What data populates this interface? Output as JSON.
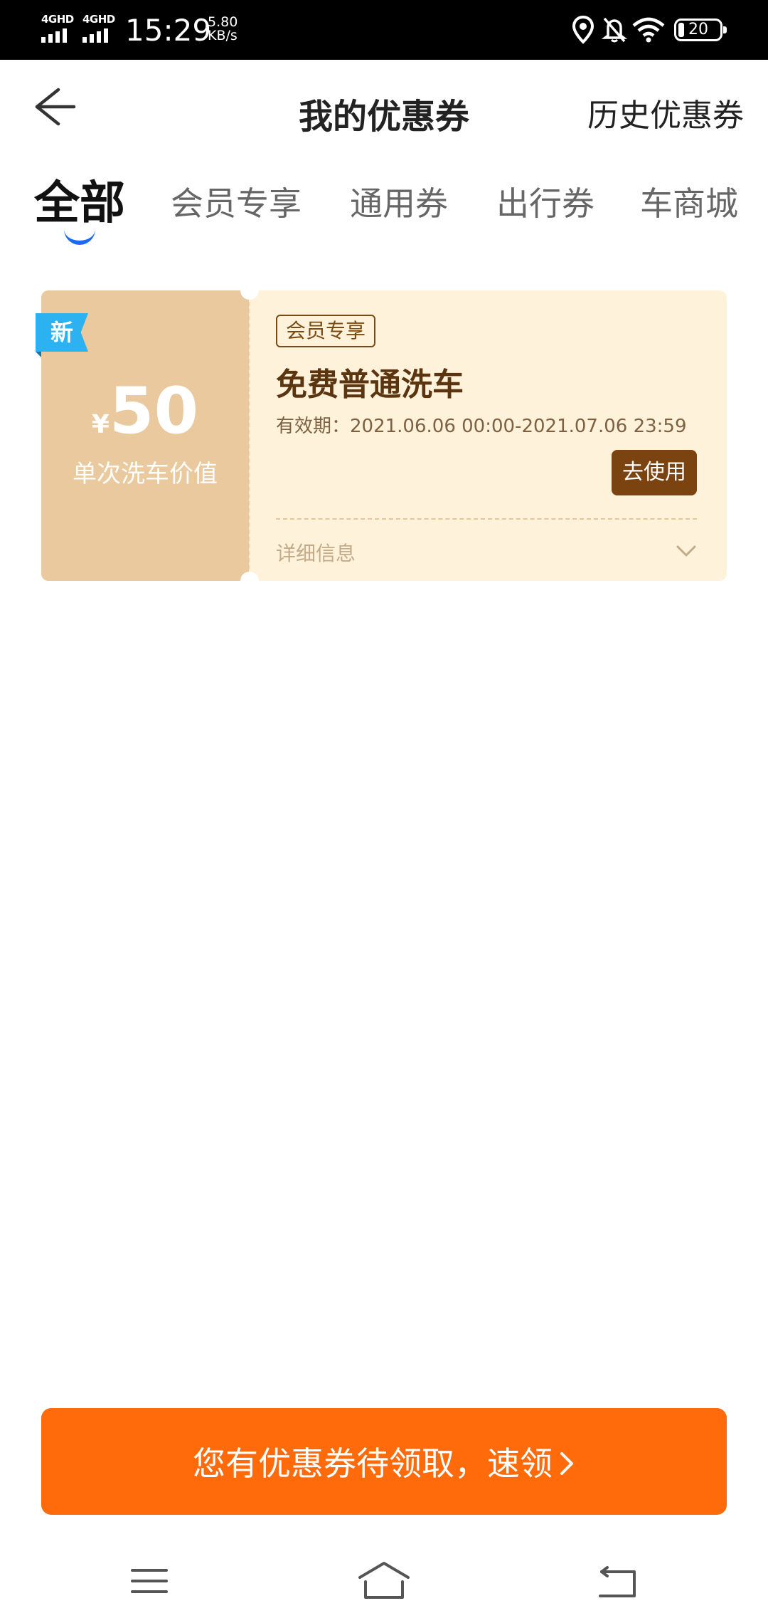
{
  "status_bar": {
    "network_1": "4GHD",
    "network_2": "4GHD",
    "time": "15:29",
    "speed_value": "5.80",
    "speed_unit": "KB/s",
    "battery": "20"
  },
  "header": {
    "title": "我的优惠券",
    "history_link": "历史优惠券"
  },
  "tabs": [
    {
      "label": "全部",
      "active": true
    },
    {
      "label": "会员专享",
      "active": false
    },
    {
      "label": "通用券",
      "active": false
    },
    {
      "label": "出行券",
      "active": false
    },
    {
      "label": "车商城",
      "active": false
    }
  ],
  "coupon": {
    "badge": "新",
    "currency": "¥",
    "amount": "50",
    "amount_desc": "单次洗车价值",
    "tag": "会员专享",
    "name": "免费普通洗车",
    "validity": "有效期：2021.06.06 00:00-2021.07.06 23:59",
    "use_button": "去使用",
    "detail_label": "详细信息"
  },
  "banner": {
    "text": "您有优惠券待领取，速领"
  },
  "colors": {
    "accent_blue": "#1b6bf0",
    "coupon_left": "#e9c99d",
    "coupon_right": "#fff2da",
    "use_button": "#7b4310",
    "badge": "#2cb2f1",
    "banner": "#ff6a0a"
  }
}
